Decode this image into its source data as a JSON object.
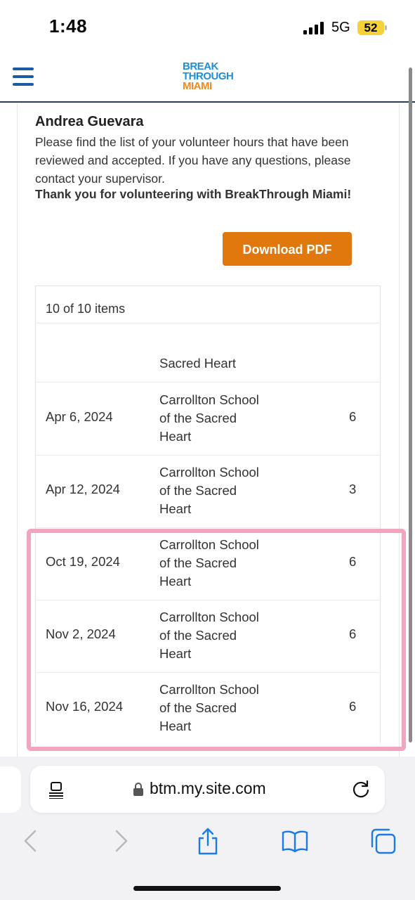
{
  "status_bar": {
    "time": "1:48",
    "network": "5G",
    "battery": "52"
  },
  "header": {
    "logo_line1": "BREAK",
    "logo_line2": "THROUGH",
    "logo_line3": "MIAMI"
  },
  "volunteer": {
    "name": "Andrea Guevara",
    "intro": "Please find the list of your volunteer hours that have been reviewed and accepted. If you have any questions, please contact your supervisor.",
    "thanks": "Thank you for volunteering with BreakThrough Miami!",
    "download_label": "Download PDF"
  },
  "table": {
    "count": "10 of 10 items",
    "partial_org": "Sacred Heart",
    "rows": [
      {
        "date": "Apr 6, 2024",
        "org": "Carrollton School of the Sacred Heart",
        "hours": "6"
      },
      {
        "date": "Apr 12, 2024",
        "org": "Carrollton School of the Sacred Heart",
        "hours": "3"
      },
      {
        "date": "Oct 19, 2024",
        "org": "Carrollton School of the Sacred Heart",
        "hours": "6"
      },
      {
        "date": "Nov 2, 2024",
        "org": "Carrollton School of the Sacred Heart",
        "hours": "6"
      },
      {
        "date": "Nov 16, 2024",
        "org": "Carrollton School of the Sacred Heart",
        "hours": "6"
      }
    ]
  },
  "browser": {
    "url": "btm.my.site.com"
  },
  "colors": {
    "accent_orange": "#e0780e",
    "nav_blue": "#1d5aa6",
    "highlight_pink": "#f2a5c1",
    "ios_blue": "#1a7ae8"
  }
}
